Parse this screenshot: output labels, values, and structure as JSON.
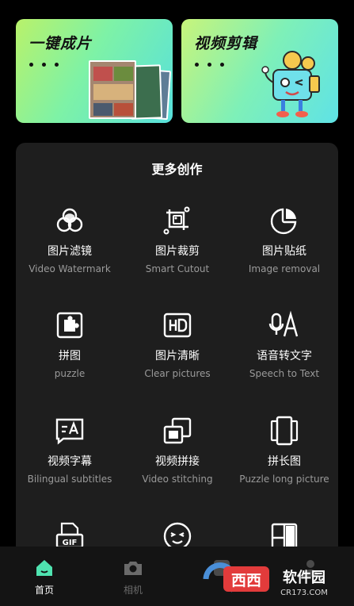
{
  "cards": [
    {
      "title": "一键成片",
      "icon": "photo-collage"
    },
    {
      "title": "视频剪辑",
      "icon": "film-robot-mascot"
    }
  ],
  "section": {
    "title": "更多创作"
  },
  "tools": [
    {
      "cn": "图片滤镜",
      "en": "Video Watermark",
      "icon": "filter-circles-icon"
    },
    {
      "cn": "图片裁剪",
      "en": "Smart Cutout",
      "icon": "crop-frame-icon"
    },
    {
      "cn": "图片贴纸",
      "en": "Image removal",
      "icon": "sticker-icon"
    },
    {
      "cn": "拼图",
      "en": "puzzle",
      "icon": "puzzle-icon"
    },
    {
      "cn": "图片清晰",
      "en": "Clear pictures",
      "icon": "hd-icon"
    },
    {
      "cn": "语音转文字",
      "en": "Speech to Text",
      "icon": "speech-to-text-icon"
    },
    {
      "cn": "视频字幕",
      "en": "Bilingual subtitles",
      "icon": "subtitle-icon"
    },
    {
      "cn": "视频拼接",
      "en": "Video stitching",
      "icon": "stitch-icon"
    },
    {
      "cn": "拼长图",
      "en": "Puzzle long picture",
      "icon": "long-picture-icon"
    },
    {
      "cn": "",
      "en": "",
      "icon": "gif-icon"
    },
    {
      "cn": "",
      "en": "",
      "icon": "face-icon"
    },
    {
      "cn": "",
      "en": "",
      "icon": "layout-grid-icon"
    }
  ],
  "tabbar": [
    {
      "label": "首页",
      "icon": "home-icon",
      "active": true
    },
    {
      "label": "相机",
      "icon": "camera-icon",
      "active": false
    },
    {
      "label": "",
      "icon": "edit-icon",
      "active": false
    },
    {
      "label": "",
      "icon": "user-icon",
      "active": false
    }
  ],
  "watermark": {
    "brand": "西西软件园",
    "url": "CR173.COM"
  },
  "colors": {
    "accent": "#4fe3b0",
    "panel": "#1e1e1e",
    "background": "#000000"
  }
}
